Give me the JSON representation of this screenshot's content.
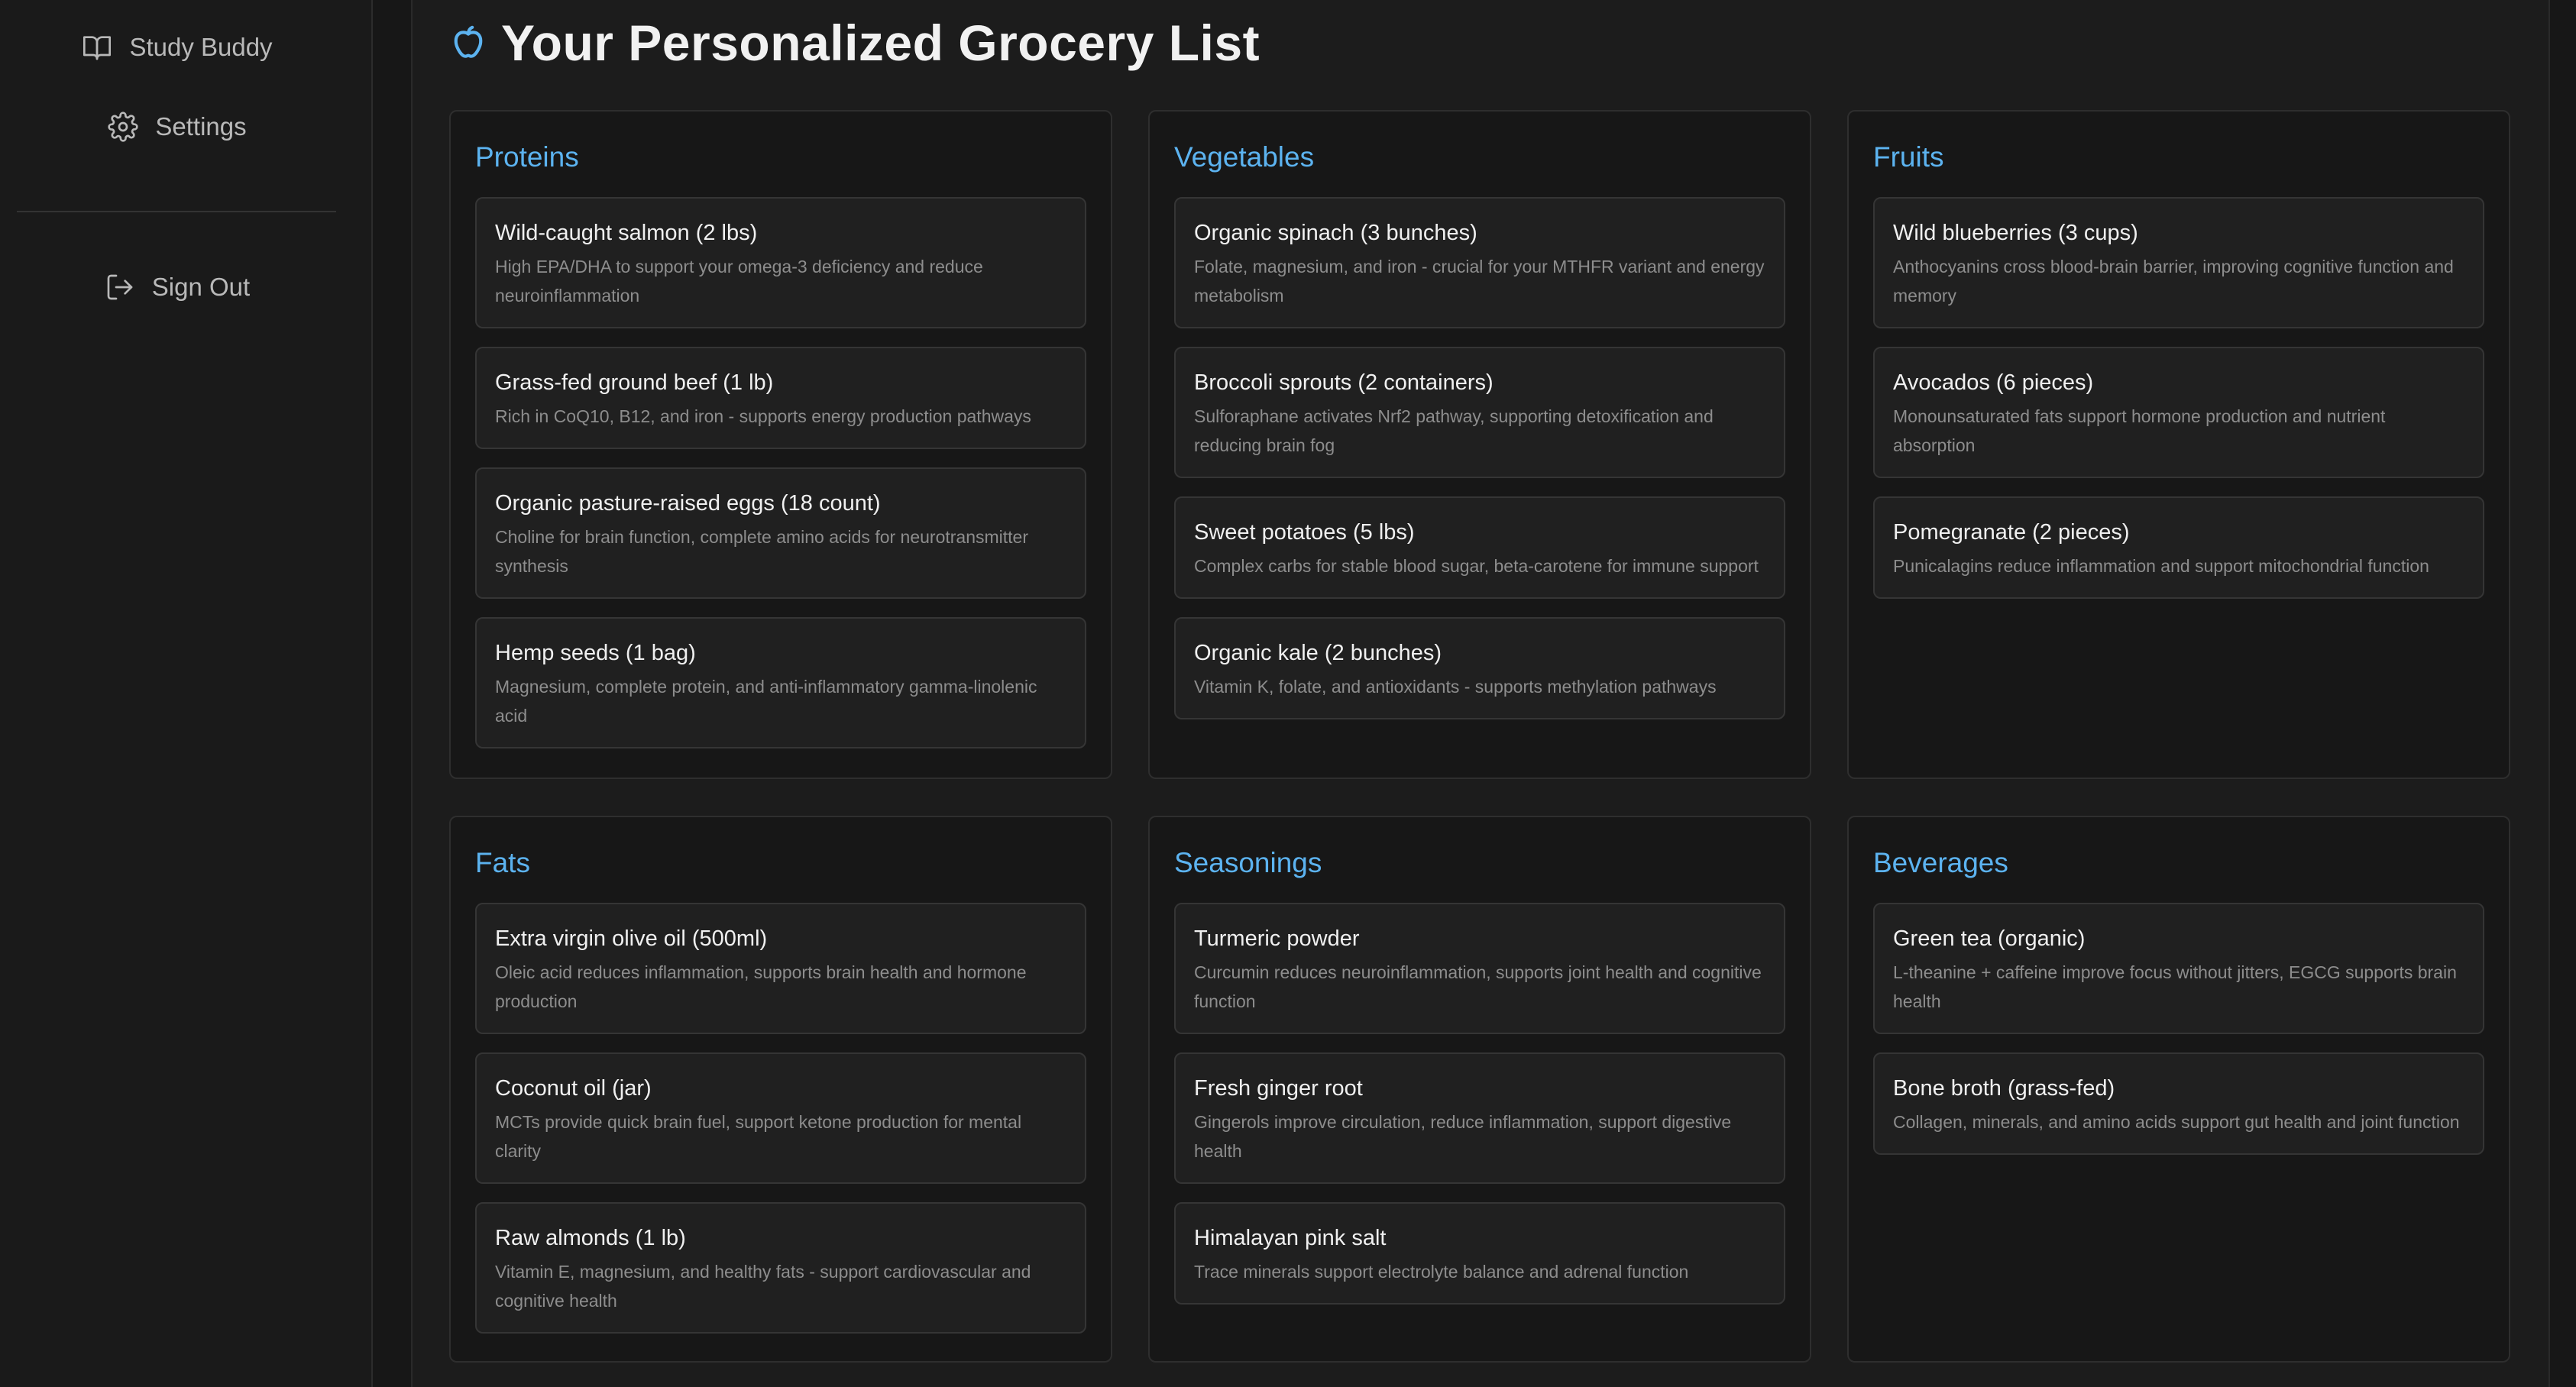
{
  "sidebar": {
    "items": [
      {
        "label": "Study Buddy",
        "icon": "book-open-icon"
      },
      {
        "label": "Settings",
        "icon": "gear-icon"
      }
    ],
    "sign_out": {
      "label": "Sign Out",
      "icon": "sign-out-icon"
    }
  },
  "header": {
    "title": "Your Personalized Grocery List",
    "icon": "apple-icon",
    "accent_color": "#5cb3f0"
  },
  "categories": [
    {
      "title": "Proteins",
      "items": [
        {
          "name": "Wild-caught salmon (2 lbs)",
          "desc": "High EPA/DHA to support your omega-3 deficiency and reduce neuroinflammation"
        },
        {
          "name": "Grass-fed ground beef (1 lb)",
          "desc": "Rich in CoQ10, B12, and iron - supports energy production pathways"
        },
        {
          "name": "Organic pasture-raised eggs (18 count)",
          "desc": "Choline for brain function, complete amino acids for neurotransmitter synthesis"
        },
        {
          "name": "Hemp seeds (1 bag)",
          "desc": "Magnesium, complete protein, and anti-inflammatory gamma-linolenic acid"
        }
      ]
    },
    {
      "title": "Vegetables",
      "items": [
        {
          "name": "Organic spinach (3 bunches)",
          "desc": "Folate, magnesium, and iron - crucial for your MTHFR variant and energy metabolism"
        },
        {
          "name": "Broccoli sprouts (2 containers)",
          "desc": "Sulforaphane activates Nrf2 pathway, supporting detoxification and reducing brain fog"
        },
        {
          "name": "Sweet potatoes (5 lbs)",
          "desc": "Complex carbs for stable blood sugar, beta-carotene for immune support"
        },
        {
          "name": "Organic kale (2 bunches)",
          "desc": "Vitamin K, folate, and antioxidants - supports methylation pathways"
        }
      ]
    },
    {
      "title": "Fruits",
      "items": [
        {
          "name": "Wild blueberries (3 cups)",
          "desc": "Anthocyanins cross blood-brain barrier, improving cognitive function and memory"
        },
        {
          "name": "Avocados (6 pieces)",
          "desc": "Monounsaturated fats support hormone production and nutrient absorption"
        },
        {
          "name": "Pomegranate (2 pieces)",
          "desc": "Punicalagins reduce inflammation and support mitochondrial function"
        }
      ]
    },
    {
      "title": "Fats",
      "items": [
        {
          "name": "Extra virgin olive oil (500ml)",
          "desc": "Oleic acid reduces inflammation, supports brain health and hormone production"
        },
        {
          "name": "Coconut oil (jar)",
          "desc": "MCTs provide quick brain fuel, support ketone production for mental clarity"
        },
        {
          "name": "Raw almonds (1 lb)",
          "desc": "Vitamin E, magnesium, and healthy fats - support cardiovascular and cognitive health"
        }
      ]
    },
    {
      "title": "Seasonings",
      "items": [
        {
          "name": "Turmeric powder",
          "desc": "Curcumin reduces neuroinflammation, supports joint health and cognitive function"
        },
        {
          "name": "Fresh ginger root",
          "desc": "Gingerols improve circulation, reduce inflammation, support digestive health"
        },
        {
          "name": "Himalayan pink salt",
          "desc": "Trace minerals support electrolyte balance and adrenal function"
        }
      ]
    },
    {
      "title": "Beverages",
      "items": [
        {
          "name": "Green tea (organic)",
          "desc": "L-theanine + caffeine improve focus without jitters, EGCG supports brain health"
        },
        {
          "name": "Bone broth (grass-fed)",
          "desc": "Collagen, minerals, and amino acids support gut health and joint function"
        }
      ]
    }
  ]
}
